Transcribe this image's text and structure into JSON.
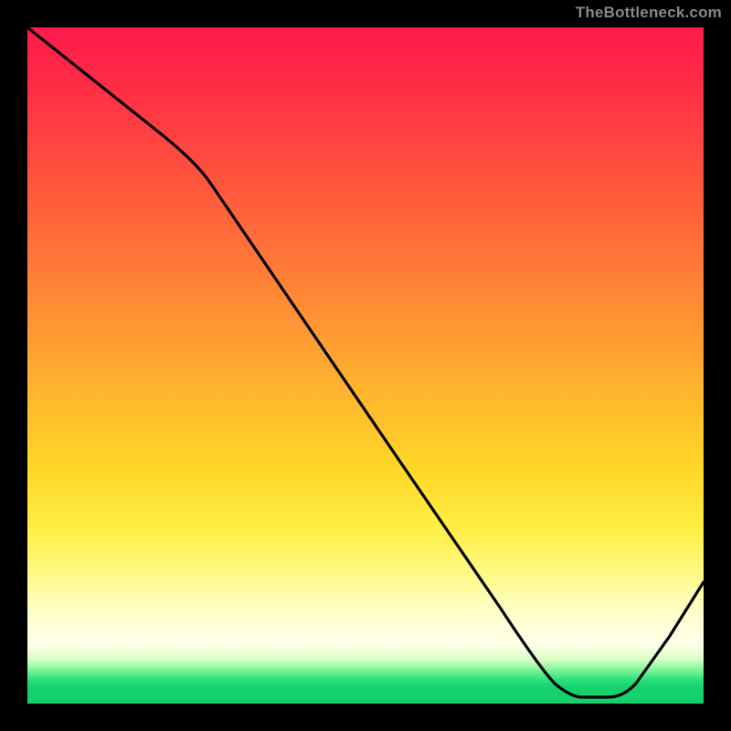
{
  "watermark": "TheBottleneck.com",
  "label_optimal": "",
  "chart_data": {
    "type": "line",
    "title": "",
    "xlabel": "",
    "ylabel": "",
    "xlim": [
      0,
      100
    ],
    "ylim": [
      0,
      100
    ],
    "series": [
      {
        "name": "bottleneck-curve",
        "x": [
          0,
          10,
          20,
          25,
          40,
          55,
          70,
          78,
          82,
          86,
          90,
          95,
          100
        ],
        "y": [
          100,
          92,
          84,
          80,
          58,
          36,
          14,
          3,
          1,
          1,
          3,
          10,
          18
        ]
      }
    ],
    "annotations": [
      {
        "name": "optimal-band",
        "y_range": [
          0,
          4
        ]
      }
    ],
    "gradient_scale": {
      "axis": "y",
      "stops": [
        {
          "y": 100,
          "color": "#ff1a4d"
        },
        {
          "y": 70,
          "color": "#ff6a3a"
        },
        {
          "y": 40,
          "color": "#ffd928"
        },
        {
          "y": 15,
          "color": "#fffca0"
        },
        {
          "y": 4,
          "color": "#7ef59a"
        },
        {
          "y": 0,
          "color": "#14cf6b"
        }
      ]
    }
  }
}
